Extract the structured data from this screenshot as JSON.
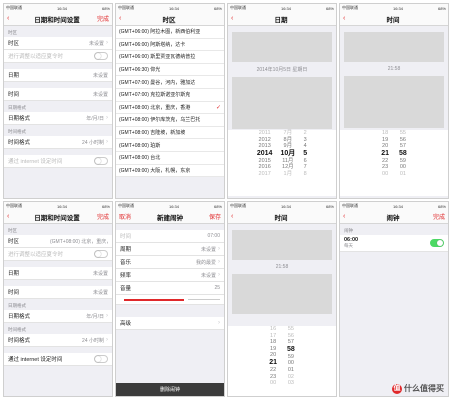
{
  "status": {
    "carrier": "中国联通",
    "time": "16:34",
    "battery": "68%"
  },
  "p1": {
    "title": "日期和时间设置",
    "done": "完成",
    "s1": "时区",
    "tz_label": "时区",
    "tz_val": "未设置",
    "auto_dst": "进行调整以适应夏令时",
    "s2": "",
    "date": "日期",
    "date_val": "未设置",
    "time": "时间",
    "time_val": "未设置",
    "s3": "日期格式",
    "date_fmt": "日期格式",
    "date_fmt_val": "年/月/日",
    "s4": "时间格式",
    "time_fmt": "时间格式",
    "time_fmt_val": "24 小时制",
    "net": "通过 internet 设定时间"
  },
  "p2": {
    "title": "时区",
    "back": "‹",
    "zones": [
      "(GMT+06:00) 阿拉木图，新西伯利亚",
      "(GMT+06:00) 阿斯塔纳，达卡",
      "(GMT+06:00) 斯里贾亚瓦德纳普拉",
      "(GMT+06:30) 仰光",
      "(GMT+07:00) 曼谷，河内，雅加达",
      "(GMT+07:00) 克拉斯诺亚尔斯克",
      "(GMT+08:00) 北京，重庆，香港",
      "(GMT+08:00) 伊尔库茨克，乌兰巴托",
      "(GMT+08:00) 吉隆坡，新加坡",
      "(GMT+08:00) 珀斯",
      "(GMT+08:00) 台北",
      "(GMT+09:00) 大阪，札幌，东京"
    ],
    "check": "✓"
  },
  "p3": {
    "title": "日期",
    "back": "‹",
    "datestr": "2014年10月5日 星期日",
    "years": [
      "2011",
      "2012",
      "2013",
      "2014",
      "2015",
      "2016",
      "2017"
    ],
    "months": [
      "7月",
      "8月",
      "9月",
      "10月",
      "11月",
      "12月",
      "1月"
    ],
    "days": [
      "2",
      "3",
      "4",
      "5",
      "6",
      "7",
      "8"
    ]
  },
  "p4": {
    "title": "时间",
    "back": "‹",
    "timestr": "21:58",
    "hours": [
      "18",
      "19",
      "20",
      "21",
      "22",
      "23",
      "00"
    ],
    "mins": [
      "55",
      "56",
      "57",
      "58",
      "59",
      "00",
      "01"
    ]
  },
  "p5": {
    "title": "日期和时间设置",
    "done": "完成",
    "s1": "时区",
    "tz_label": "时区",
    "tz_val": "(GMT+08:00) 北京，重庆，香港",
    "auto_dst": "进行调整以适应夏令时",
    "date": "日期",
    "date_val": "未设置",
    "time": "时间",
    "time_val": "未设置",
    "s3": "日期格式",
    "date_fmt": "日期格式",
    "date_fmt_val": "年/月/日",
    "s4": "时间格式",
    "time_fmt": "时间格式",
    "time_fmt_val": "24 小时制",
    "net": "通过 internet 设定时间"
  },
  "p6": {
    "title": "新建闹钟",
    "cancel": "取消",
    "save": "保存",
    "time": "时间",
    "time_val": "07:00",
    "repeat": "周期",
    "repeat_val": "未设置",
    "music": "音乐",
    "music_val": "我的最爱",
    "freq": "频率",
    "freq_val": "未设置",
    "vol": "音量",
    "vol_val": "25",
    "adv": "高级",
    "delete": "删除闹钟"
  },
  "p7": {
    "title": "时间",
    "back": "‹",
    "timestr": "21:58",
    "hours": [
      "16",
      "17",
      "18",
      "19",
      "20",
      "21",
      "22",
      "23",
      "00"
    ],
    "mins": [
      "55",
      "56",
      "57",
      "58",
      "59",
      "00",
      "01",
      "02",
      "03"
    ]
  },
  "p8": {
    "title": "闹钟",
    "back": "‹",
    "done": "完成",
    "section": "闹钟",
    "alarm_time": "06:00",
    "alarm_sub": "每天"
  },
  "watermark": "什么值得买"
}
